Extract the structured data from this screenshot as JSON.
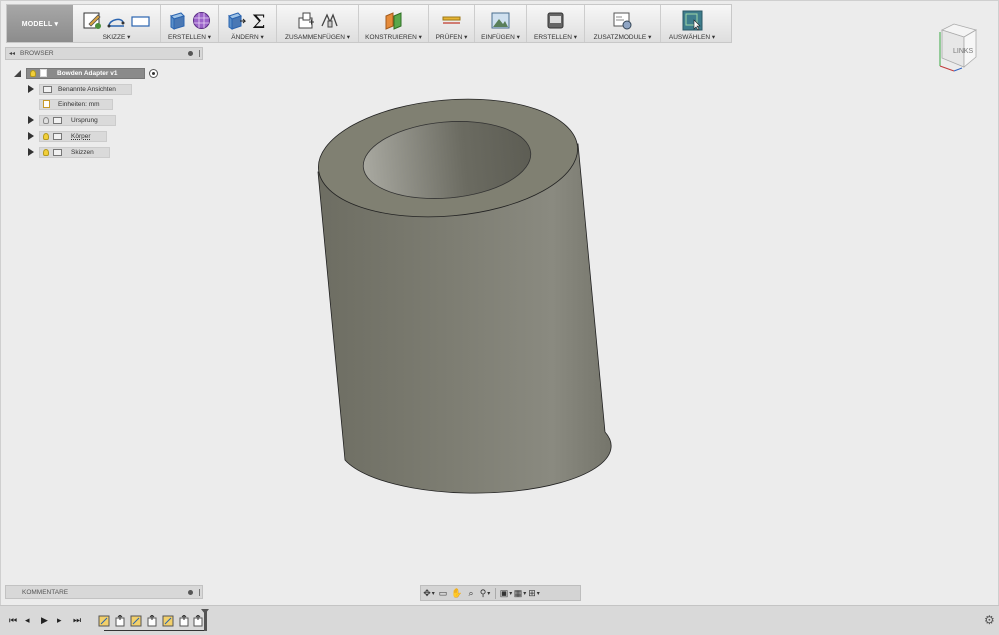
{
  "toolbar": {
    "mode_label": "MODELL ▾",
    "groups": {
      "skizze": "SKIZZE ▾",
      "erstellen": "ERSTELLEN ▾",
      "aendern": "ÄNDERN ▾",
      "zusammenfuegen": "ZUSAMMENFÜGEN ▾",
      "konstruieren": "KONSTRUIEREN ▾",
      "pruefen": "PRÜFEN ▾",
      "einfuegen": "EINFÜGEN ▾",
      "erstellen2": "ERSTELLEN ▾",
      "zusatzmodule": "ZUSATZMODULE ▾",
      "auswaehlen": "AUSWÄHLEN ▾"
    }
  },
  "browser": {
    "header": "BROWSER",
    "root": "Bowden Adapter v1",
    "items": [
      {
        "label": "Benannte Ansichten"
      },
      {
        "label": "Einheiten: mm"
      },
      {
        "label": "Ursprung"
      },
      {
        "label": "Körper"
      },
      {
        "label": "Skizzen"
      }
    ]
  },
  "viewcube": {
    "face_label": "LINKS"
  },
  "comments": {
    "header": "KOMMENTARE"
  },
  "colors": {
    "model_body": "#7a7a6e",
    "toolbar_bg": "#e6e6e6",
    "accent_select": "#3e7d8c"
  }
}
